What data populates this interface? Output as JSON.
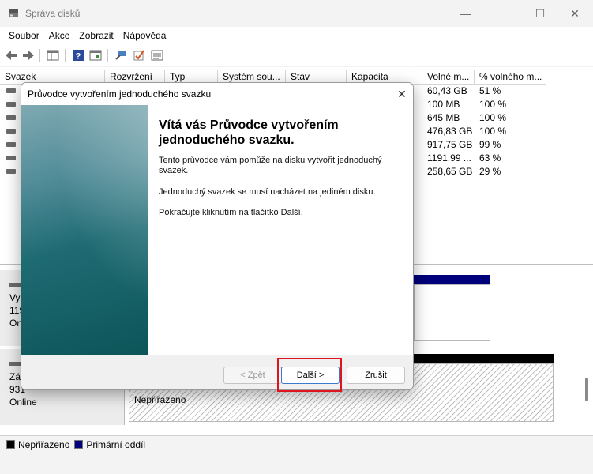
{
  "window": {
    "title": "Správa disků",
    "min_glyph": "—",
    "max_glyph": "☐",
    "close_glyph": "✕"
  },
  "menu": [
    "Soubor",
    "Akce",
    "Zobrazit",
    "Nápověda"
  ],
  "toolbar_icons": [
    "back-arrow-icon",
    "forward-arrow-icon",
    "console-tree-icon",
    "help-icon",
    "properties-icon",
    "connect-icon",
    "check-icon",
    "list-icon"
  ],
  "columns": [
    "Svazek",
    "Rozvržení",
    "Typ",
    "Systém sou...",
    "Stav",
    "Kapacita",
    "Volné m...",
    "% volného m..."
  ],
  "rows": [
    {
      "first": "",
      "free": "60,43 GB",
      "pct": "51 %"
    },
    {
      "first": "",
      "free": "100 MB",
      "pct": "100 %"
    },
    {
      "first": "",
      "free": "645 MB",
      "pct": "100 %"
    },
    {
      "first": "",
      "free": "476,83 GB",
      "pct": "100 %"
    },
    {
      "first": "",
      "free": "917,75 GB",
      "pct": "99 %"
    },
    {
      "first": "",
      "free": "1191,99 ...",
      "pct": "63 %"
    },
    {
      "first": "",
      "free": "258,65 GB",
      "pct": "29 %"
    }
  ],
  "disks": [
    {
      "line1": "Vy",
      "line2": "119",
      "line3": "On"
    },
    {
      "line1": "Zá",
      "line2": "931",
      "line3": "Online",
      "unalloc_label": "Nepřiřazeno"
    }
  ],
  "legend": [
    {
      "label": "Nepřiřazeno",
      "color": "#000000"
    },
    {
      "label": "Primární oddíl",
      "color": "#00007a"
    }
  ],
  "dialog": {
    "title": "Průvodce vytvořením jednoduchého svazku",
    "close_glyph": "✕",
    "heading": "Vítá vás Průvodce vytvořením jednoduchého svazku.",
    "para1": "Tento průvodce vám pomůže na disku vytvořit jednoduchý svazek.",
    "para2": "Jednoduchý svazek se musí nacházet na jediném disku.",
    "para3": "Pokračujte kliknutím na tlačítko Další.",
    "back_label": "< Zpět",
    "next_label": "Další >",
    "cancel_label": "Zrušit"
  }
}
